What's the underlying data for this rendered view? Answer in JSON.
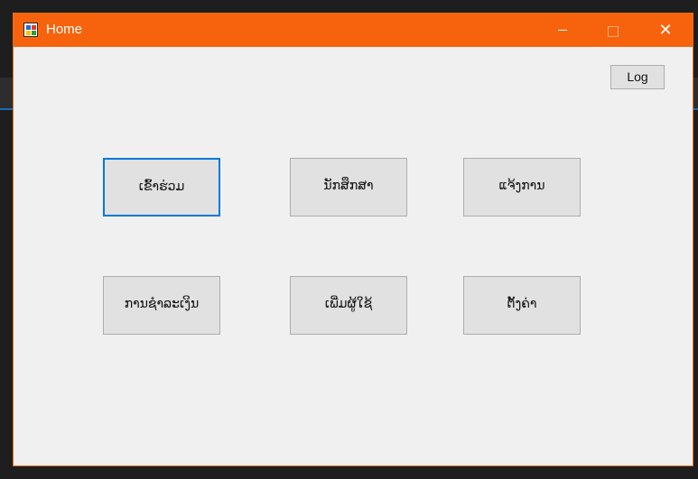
{
  "window": {
    "title": "Home",
    "icon": "app-window-icon",
    "controls": {
      "minimize_icon": "minimize-icon",
      "maximize_icon": "maximize-icon",
      "close_icon": "close-icon",
      "close_glyph": "✕"
    },
    "titlebar_color": "#f7630c"
  },
  "log_button": {
    "label": "Log"
  },
  "buttons": [
    {
      "label": "ເຂົ້າຮ່ວມ",
      "focused": true
    },
    {
      "label": "ນັກສຶກສາ",
      "focused": false
    },
    {
      "label": "ແຈ້ງການ",
      "focused": false
    },
    {
      "label": "ການຊຳລະເງິນ",
      "focused": false
    },
    {
      "label": "ເພີ່ມຜູ້ໃຊ້",
      "focused": false
    },
    {
      "label": "ຕັ້ງຄ່າ",
      "focused": false
    }
  ],
  "colors": {
    "focus_border": "#0078d7",
    "button_face": "#e1e1e1",
    "client_bg": "#f0f0f0"
  }
}
